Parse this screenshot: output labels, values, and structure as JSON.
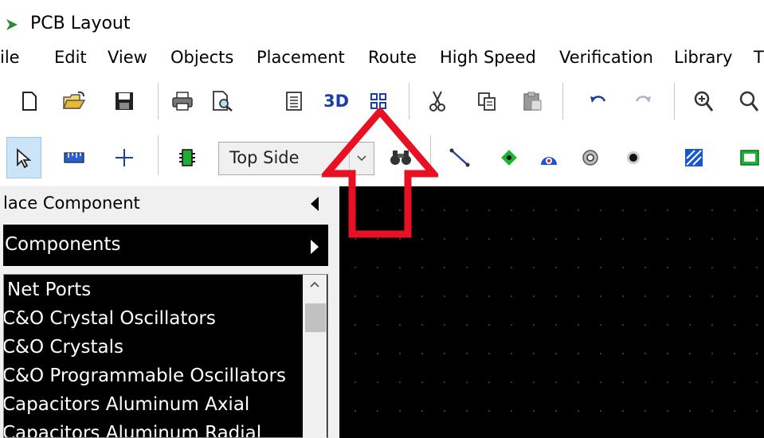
{
  "window": {
    "title": "PCB Layout"
  },
  "menu": [
    {
      "label": "File",
      "display": "ile"
    },
    {
      "label": "Edit"
    },
    {
      "label": "View"
    },
    {
      "label": "Objects"
    },
    {
      "label": "Placement"
    },
    {
      "label": "Route"
    },
    {
      "label": "High Speed"
    },
    {
      "label": "Verification"
    },
    {
      "label": "Library"
    },
    {
      "label": "T"
    }
  ],
  "toolbar1": {
    "buttons": [
      "new-file",
      "open-folder",
      "save",
      "print",
      "print-preview",
      "report",
      "3D",
      "grid-view",
      "cut",
      "copy",
      "paste",
      "undo",
      "redo",
      "zoom-in",
      "zoom-fit"
    ],
    "three_d_label": "3D"
  },
  "toolbar2": {
    "side_select_value": "Top Side",
    "buttons": [
      "select",
      "measure",
      "crosshair",
      "component",
      "find",
      "route-trace",
      "pad-square",
      "pad-arc",
      "pad-round",
      "via",
      "polygon",
      "copper-pour"
    ]
  },
  "left_panel": {
    "title": "lace Component",
    "section_label": "Components",
    "list_items": [
      "Net Ports",
      "C&O Crystal Oscillators",
      "C&O Crystals",
      "C&O Programmable Oscillators",
      "Capacitors Aluminum Axial",
      "Capacitors Aluminum Radial"
    ]
  },
  "annotation": {
    "arrow_color": "#e81123",
    "points_to": "grid-view button"
  }
}
